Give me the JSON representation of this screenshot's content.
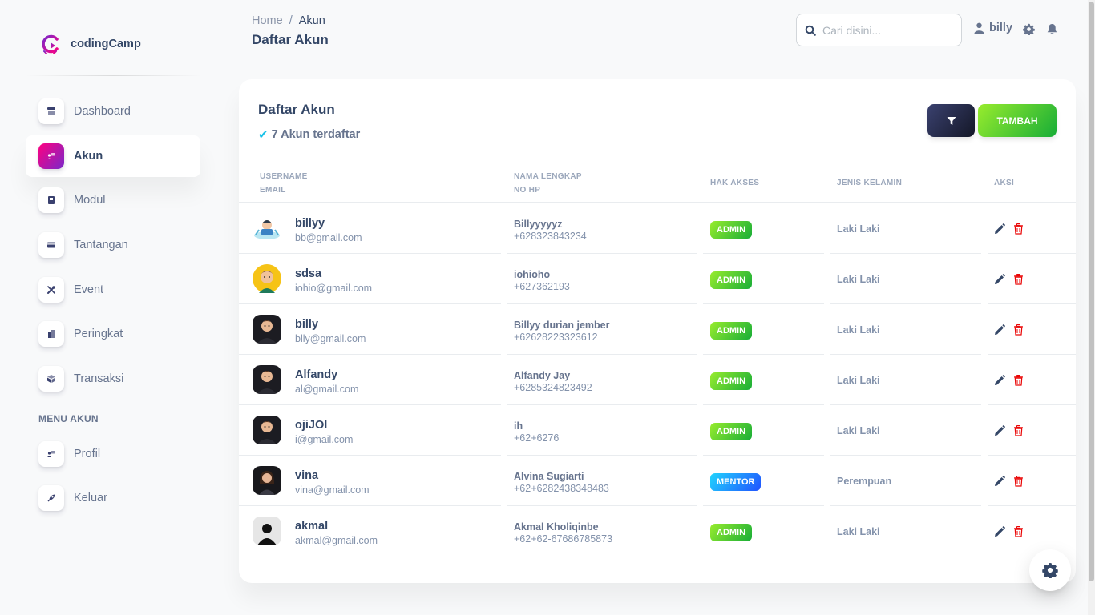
{
  "brand": {
    "name": "codingCamp"
  },
  "sidebar": {
    "items": [
      {
        "label": "Dashboard",
        "icon": "shop-icon",
        "active": false
      },
      {
        "label": "Akun",
        "icon": "users-icon",
        "active": true
      },
      {
        "label": "Modul",
        "icon": "book-icon",
        "active": false
      },
      {
        "label": "Tantangan",
        "icon": "credit-card-icon",
        "active": false
      },
      {
        "label": "Event",
        "icon": "tools-icon",
        "active": false
      },
      {
        "label": "Peringkat",
        "icon": "building-icon",
        "active": false
      },
      {
        "label": "Transaksi",
        "icon": "box-icon",
        "active": false
      }
    ],
    "section_title": "MENU AKUN",
    "account_items": [
      {
        "label": "Profil",
        "icon": "users-icon"
      },
      {
        "label": "Keluar",
        "icon": "rocket-icon"
      }
    ]
  },
  "header": {
    "breadcrumb": {
      "home": "Home",
      "separator": "/",
      "current": "Akun"
    },
    "title": "Daftar Akun",
    "search_placeholder": "Cari disini...",
    "username": "billy"
  },
  "card": {
    "title": "Daftar Akun",
    "subtitle": "7 Akun terdaftar",
    "add_button": "TAMBAH"
  },
  "table": {
    "headers": {
      "username": "USERNAME",
      "email": "EMAIL",
      "fullname": "NAMA LENGKAP",
      "phone": "NO HP",
      "role": "HAK AKSES",
      "gender": "JENIS KELAMIN",
      "action": "AKSI"
    },
    "rows": [
      {
        "username": "billyy",
        "email": "bb@gmail.com",
        "fullname": "Billyyyyyz",
        "phone": "+628323843234",
        "role": "ADMIN",
        "gender": "Laki Laki"
      },
      {
        "username": "sdsa",
        "email": "iohio@gmail.com",
        "fullname": "iohioho",
        "phone": "+627362193",
        "role": "ADMIN",
        "gender": "Laki Laki"
      },
      {
        "username": "billy",
        "email": "blly@gmail.com",
        "fullname": "Billyy durian jember",
        "phone": "+62628223323612",
        "role": "ADMIN",
        "gender": "Laki Laki"
      },
      {
        "username": "Alfandy",
        "email": "al@gmail.com",
        "fullname": "Alfandy Jay",
        "phone": "+6285324823492",
        "role": "ADMIN",
        "gender": "Laki Laki"
      },
      {
        "username": "ojiJOI",
        "email": "i@gmail.com",
        "fullname": "ih",
        "phone": "+62+6276",
        "role": "ADMIN",
        "gender": "Laki Laki"
      },
      {
        "username": "vina",
        "email": "vina@gmail.com",
        "fullname": "Alvina Sugiarti",
        "phone": "+62+6282438348483",
        "role": "MENTOR",
        "gender": "Perempuan"
      },
      {
        "username": "akmal",
        "email": "akmal@gmail.com",
        "fullname": "Akmal Kholiqinbe",
        "phone": "+62+62-67686785873",
        "role": "ADMIN",
        "gender": "Laki Laki"
      }
    ]
  },
  "colors": {
    "primary_gradient": [
      "#7928ca",
      "#ff0080"
    ],
    "success_gradient": [
      "#17ad37",
      "#98ec2d"
    ],
    "info_gradient": [
      "#2152ff",
      "#21d4fd"
    ],
    "dark_gradient": [
      "#141727",
      "#3a416f"
    ],
    "danger": "#ea0606"
  }
}
